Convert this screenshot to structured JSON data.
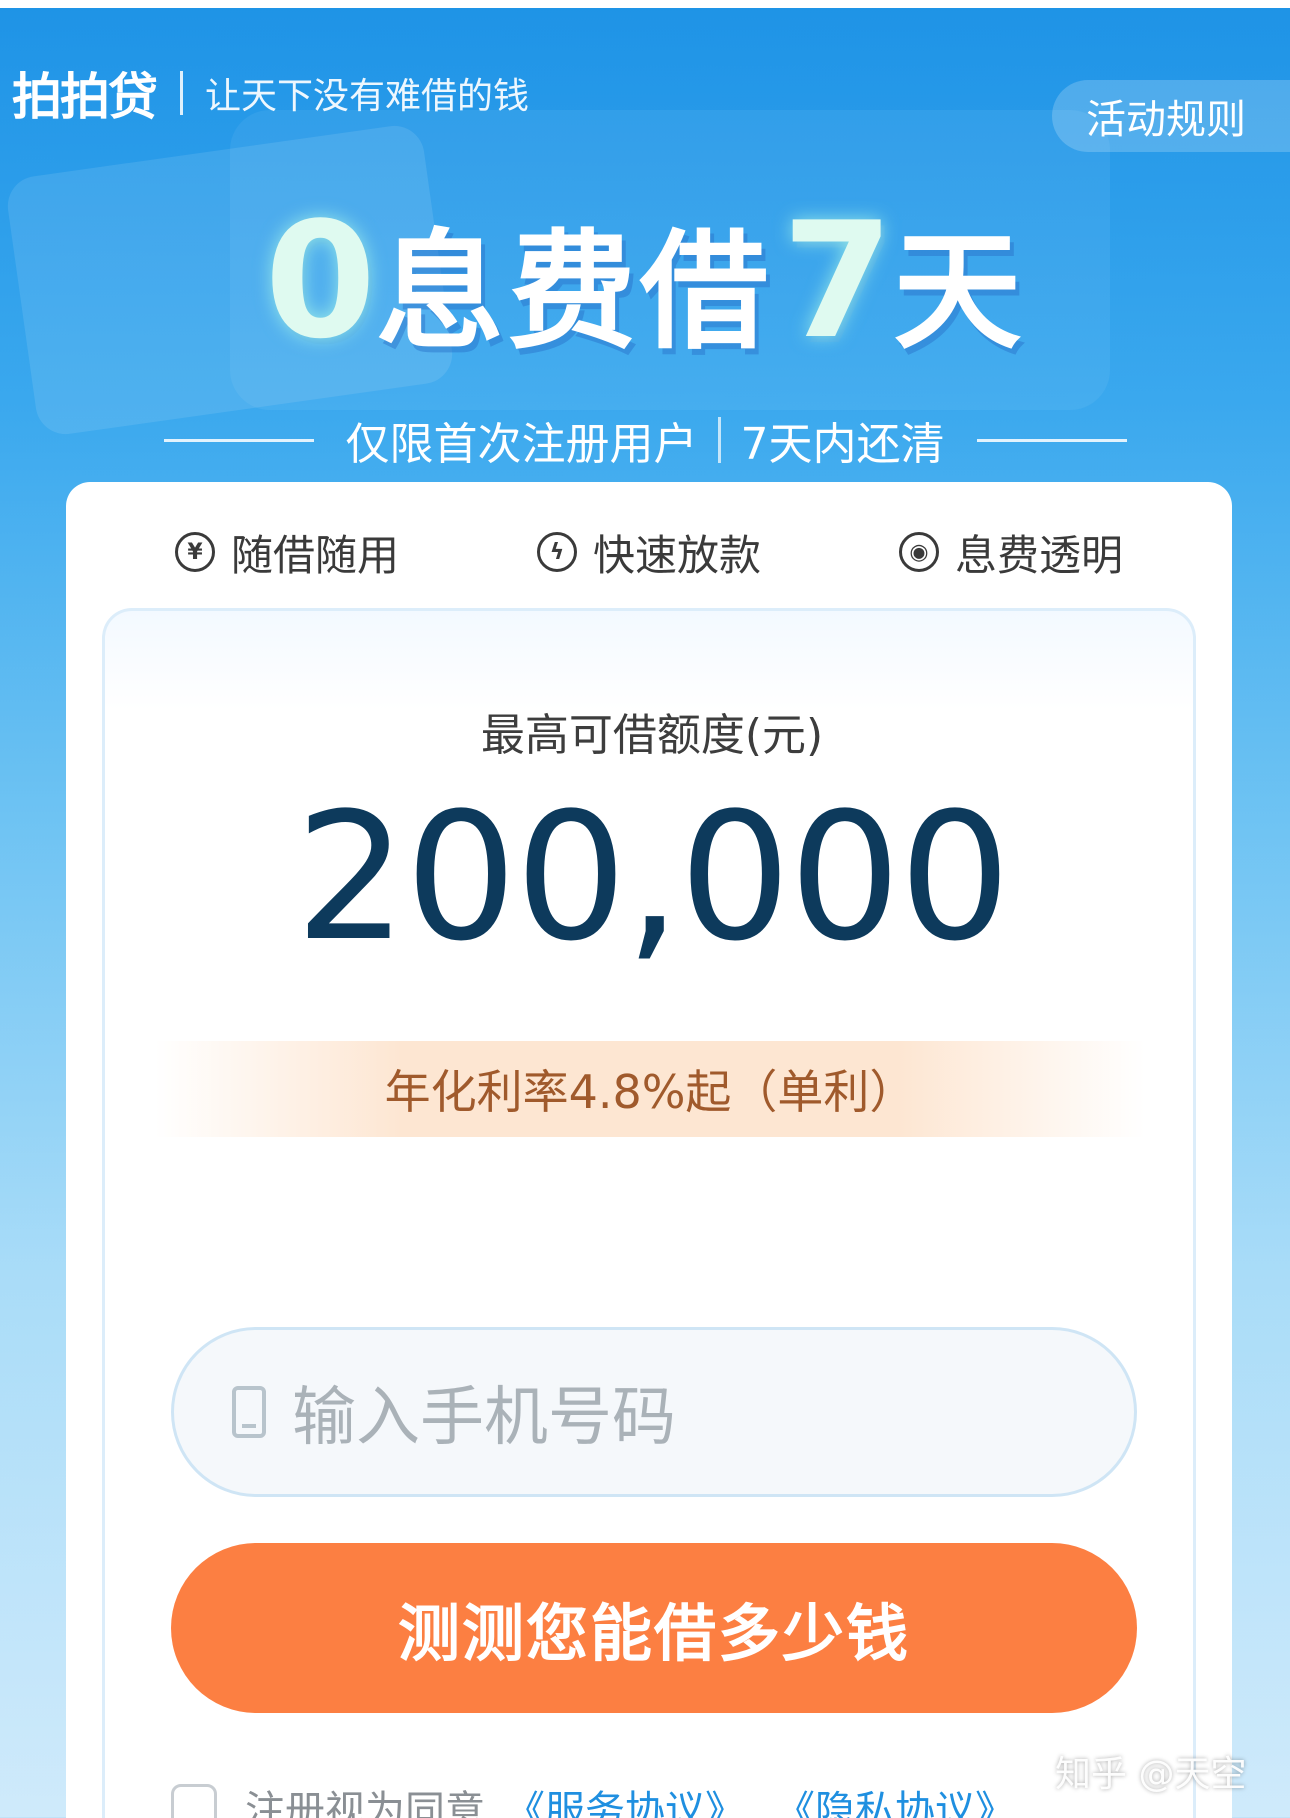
{
  "header": {
    "logo": "拍拍贷",
    "slogan": "让天下没有难借的钱"
  },
  "rules_button": "活动规则",
  "headline": {
    "digit1": "0",
    "text1": "息费借",
    "digit2": "7",
    "text2": "天"
  },
  "subline": {
    "left": "仅限首次注册用户",
    "right": "7天内还清"
  },
  "features": [
    {
      "icon": "yuan-circle-icon",
      "glyph": "¥",
      "label": "随借随用"
    },
    {
      "icon": "lightning-icon",
      "glyph": "ϟ",
      "label": "快速放款"
    },
    {
      "icon": "eye-icon",
      "glyph": "◉",
      "label": "息费透明"
    }
  ],
  "limit": {
    "label": "最高可借额度(元)",
    "value": "200,000"
  },
  "rate": "年化利率4.8%起（单利）",
  "phone_input": {
    "placeholder": "输入手机号码",
    "icon": "phone-icon"
  },
  "cta": "测测您能借多少钱",
  "agreement": {
    "text": "注册视为同意",
    "service": "《服务协议》",
    "privacy": "《隐私协议》"
  },
  "watermark": "知乎 @天空",
  "colors": {
    "cta": "#fc7f42",
    "amount": "#0d3a5c",
    "link": "#1f8fe0",
    "bg_top": "#1e93e6"
  }
}
